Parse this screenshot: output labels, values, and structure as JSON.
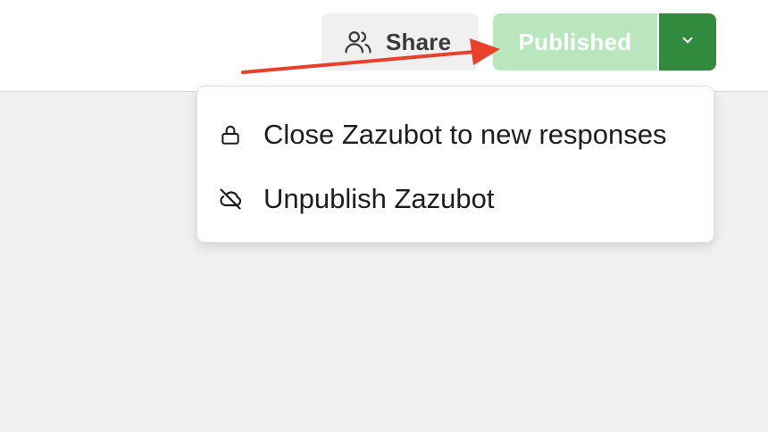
{
  "header": {
    "share_label": "Share",
    "share_icon": "users-icon",
    "publish_label": "Published",
    "dropdown_icon": "chevron-down-icon"
  },
  "menu": {
    "items": [
      {
        "label": "Close Zazubot to new responses",
        "icon": "lock-icon"
      },
      {
        "label": "Unpublish Zazubot",
        "icon": "cloud-off-icon"
      }
    ]
  },
  "colors": {
    "published_bg": "#b9e6bd",
    "dropdown_bg": "#328a3f",
    "annotation_arrow": "#e8412b"
  }
}
